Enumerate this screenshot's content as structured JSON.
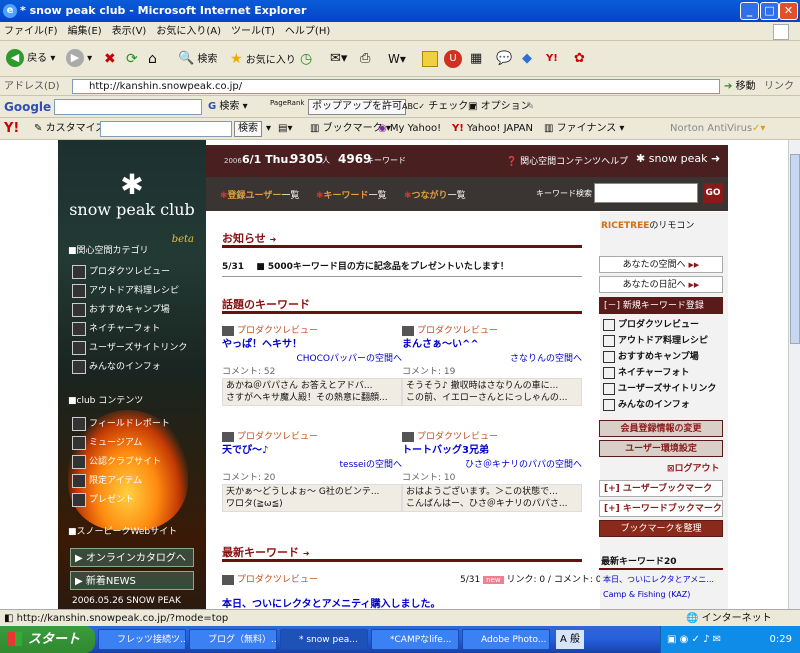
{
  "window": {
    "title": "* snow peak club - Microsoft Internet Explorer"
  },
  "menu": [
    "ファイル(F)",
    "編集(E)",
    "表示(V)",
    "お気に入り(A)",
    "ツール(T)",
    "ヘルプ(H)"
  ],
  "toolbar": {
    "back": "戻る",
    "search": "検索",
    "favorites": "お気に入り"
  },
  "address": {
    "label": "アドレス(D)",
    "url": "http://kanshin.snowpeak.co.jp/",
    "go": "移動",
    "links": "リンク"
  },
  "google": {
    "label": "Google",
    "search": "検索",
    "pagerank": "PageRank",
    "popup": "ポップアップを許可",
    "check": "チェック",
    "options": "オプション"
  },
  "yahoo": {
    "customize": "カスタマイズ",
    "search": "検索",
    "bookmark": "ブックマーク",
    "myyahoo": "My Yahoo!",
    "japan": "Yahoo! JAPAN",
    "finance": "ファイナンス",
    "norton": "Norton AntiVirus"
  },
  "sidebar": {
    "brand": "snow peak club",
    "beta": "beta",
    "sec1": "■関心空間カテゴリ",
    "nav1": [
      "プロダクツレビュー",
      "アウトドア料理レシピ",
      "おすすめキャンプ場",
      "ネイチャーフォト",
      "ユーザーズサイトリンク",
      "みんなのインフォ"
    ],
    "sec2": "■club コンテンツ",
    "nav2": [
      "フィールドレポート",
      "ミュージアム",
      "公認クラブサイト",
      "限定アイテム",
      "プレゼント"
    ],
    "sec3": "■スノーピークWebサイト",
    "btn1": "▶ オンラインカタログへ",
    "btn2": "▶ 新着NEWS",
    "news_date": "2006.05.26 SNOW PEAK"
  },
  "topstrip": {
    "year": "2006",
    "date": "6/1 Thu.",
    "users": "9305",
    "users_unit": "人",
    "keywords": "4969",
    "keywords_unit": "キーワード",
    "help": "関心空間コンテンツヘルプ",
    "brand": "snow peak"
  },
  "keyrow": {
    "users": "登録ユーザー",
    "users_sfx": "一覧",
    "keywords": "キーワード",
    "keywords_sfx": "一覧",
    "links": "つながり",
    "links_sfx": "一覧",
    "search_label": "キーワード検索",
    "go": "GO"
  },
  "notice": {
    "heading": "お知らせ",
    "date": "5/31",
    "text": "■ 5000キーワード目の方に記念品をプレゼントいたします！"
  },
  "hot": {
    "heading": "話題のキーワード",
    "cards": [
      {
        "cat": "プロダクツレビュー",
        "title": "やっぱ！ヘキサ！",
        "who": "CHOCOパッパーの空間へ",
        "count": "コメント: 52",
        "c1": "あかね＠パパさん お答えとアドバ...",
        "c2": "さすがヘキサ魔人殿！その熱意に翻顔..."
      },
      {
        "cat": "プロダクツレビュー",
        "title": "まんさぁ～い^^",
        "who": "さなりんの空間へ",
        "count": "コメント: 19",
        "c1": "そうそう♪ 撤収時はさなりんの車に...",
        "c2": "この前、イエローさんとにっしゃんの..."
      },
      {
        "cat": "プロダクツレビュー",
        "title": "天でぴ～♪",
        "who": "tesseiの空間へ",
        "count": "コメント: 20",
        "c1": "天かぁ～どうしよぉ～ G社のビンテ...",
        "c2": "ワロタ(≧ω≦)"
      },
      {
        "cat": "プロダクツレビュー",
        "title": "トートバッグ3兄弟",
        "who": "ひさ＠キナリのパパの空間へ",
        "count": "コメント: 10",
        "c1": "おはようございます。＞この状態で...",
        "c2": "こんばんはー、ひさ＠キナリのパパさ..."
      }
    ]
  },
  "latest": {
    "heading": "最新キーワード",
    "cat": "プロダクツレビュー",
    "date": "5/31",
    "badge": "new",
    "links": "リンク: 0",
    "comments": "コメント: 0",
    "title": "本日、ついにレクタとアメニティ購入しました。"
  },
  "right": {
    "brand": "RICETREE",
    "brand_sfx": "のリモコン",
    "b1": "あなたの空間へ",
    "b2": "あなたの日記へ",
    "b3": "[－] 新規キーワード登録",
    "nav": [
      "プロダクツレビュー",
      "アウトドア料理レシピ",
      "おすすめキャンプ場",
      "ネイチャーフォト",
      "ユーザーズサイトリンク",
      "みんなのインフォ"
    ],
    "b4": "会員登録情報の変更",
    "b5": "ユーザー環境設定",
    "logout": "ログアウト",
    "b6": "[+] ユーザーブックマーク",
    "b7": "[+] キーワードブックマーク",
    "b8": "ブックマークを整理",
    "latest20": "最新キーワード20",
    "l1": "本日、ついにレクタとアメニ...",
    "l2": "Camp & Fishing (KAZ)"
  },
  "status": {
    "url": "http://kanshin.snowpeak.co.jp/?mode=top",
    "zone": "インターネット"
  },
  "taskbar": {
    "start": "スタート",
    "tasks": [
      "フレッツ接続ツ...",
      "ブログ（無料）...",
      "* snow pea...",
      "*CAMPなlife...",
      "Adobe Photo..."
    ],
    "ime": "A 般",
    "clock": "0:29"
  }
}
